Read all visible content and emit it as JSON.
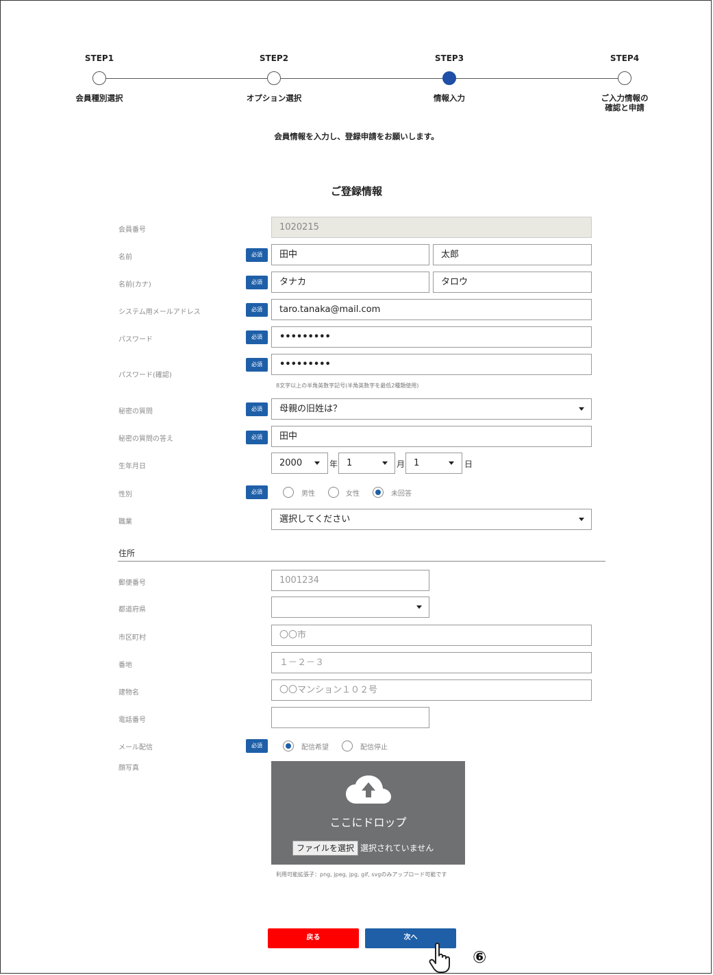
{
  "stepper": {
    "steps": [
      {
        "title": "STEP1",
        "label": "会員種別選択"
      },
      {
        "title": "STEP2",
        "label": "オプション選択"
      },
      {
        "title": "STEP3",
        "label": "情報入力"
      },
      {
        "title": "STEP4",
        "label": "ご入力情報の\n確認と申請"
      }
    ],
    "active_step": 3,
    "active_color": "#1f4fa6"
  },
  "intro": "会員情報を入力し、登録申請をお願いします。",
  "section_title": "ご登録情報",
  "required_label": "必須",
  "form": {
    "member_number": {
      "label": "会員番号",
      "value": "1020215"
    },
    "name": {
      "label": "名前",
      "last": "田中",
      "first": "太郎"
    },
    "name_kana": {
      "label": "名前(カナ)",
      "last": "タナカ",
      "first": "タロウ"
    },
    "email": {
      "label": "システム用メールアドレス",
      "value": "taro.tanaka@mail.com"
    },
    "password": {
      "label": "パスワード",
      "value": "•••••••••"
    },
    "password_confirm": {
      "label": "パスワード(確認)",
      "value": "•••••••••",
      "hint": "8文字以上の半角英数字記号(半角英数字を最低2種類使用)"
    },
    "secret_question": {
      "label": "秘密の質問",
      "value": "母親の旧姓は？"
    },
    "secret_answer": {
      "label": "秘密の質問の答え",
      "value": "田中"
    },
    "birthdate": {
      "label": "生年月日",
      "year": "2000",
      "year_unit": "年",
      "month": "1",
      "month_unit": "月",
      "day": "1",
      "day_unit": "日"
    },
    "gender": {
      "label": "性別",
      "options": [
        "男性",
        "女性",
        "未回答"
      ],
      "selected": "未回答"
    },
    "occupation": {
      "label": "職業",
      "value": "選択してください"
    }
  },
  "address": {
    "heading": "住所",
    "postal_code": {
      "label": "郵便番号",
      "placeholder": "1001234"
    },
    "prefecture": {
      "label": "都道府県",
      "value": ""
    },
    "city": {
      "label": "市区町村",
      "placeholder": "〇〇市"
    },
    "street": {
      "label": "番地",
      "placeholder": "１－２－３"
    },
    "building": {
      "label": "建物名",
      "placeholder": "〇〇マンション１０２号"
    },
    "phone": {
      "label": "電話番号",
      "value": ""
    },
    "mail_delivery": {
      "label": "メール配信",
      "options": [
        "配信希望",
        "配信停止"
      ],
      "selected": "配信希望"
    },
    "photo": {
      "label": "顔写真",
      "drop_text": "ここにドロップ",
      "file_button": "ファイルを選択",
      "file_status": "選択されていません",
      "hint": "利用可能拡張子：png, jpeg, jpg, gif, svgのみアップロード可能です"
    }
  },
  "buttons": {
    "back": "戻る",
    "next": "次へ",
    "back_color": "#ff0000",
    "next_color": "#1e5fa8"
  },
  "annotation": {
    "marker": "⑥",
    "icon": "pointing-hand-cursor-icon"
  }
}
